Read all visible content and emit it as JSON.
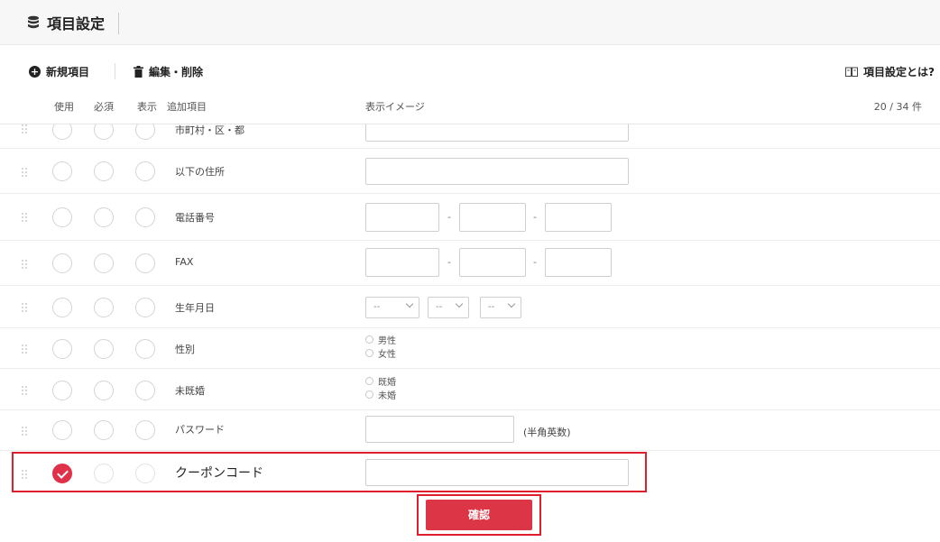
{
  "header": {
    "title": "項目設定",
    "icon": "database-icon"
  },
  "toolbar": {
    "new_label": "新規項目",
    "edit_label": "編集・削除",
    "help_label": "項目設定とは?"
  },
  "columns": {
    "use": "使用",
    "required": "必須",
    "display": "表示",
    "field": "追加項目",
    "image": "表示イメージ",
    "count": "20 / 34 件"
  },
  "rows": {
    "city": {
      "label": "市町村・区・都"
    },
    "address": {
      "label": "以下の住所"
    },
    "phone": {
      "label": "電話番号",
      "sep1": "-",
      "sep2": "-"
    },
    "fax": {
      "label": "FAX",
      "sep1": "-",
      "sep2": "-"
    },
    "birth": {
      "label": "生年月日",
      "sel1": "--",
      "sel2": "--",
      "sel3": "--"
    },
    "gender": {
      "label": "性別",
      "opt1": "男性",
      "opt2": "女性"
    },
    "marital": {
      "label": "未既婚",
      "opt1": "既婚",
      "opt2": "未婚"
    },
    "password": {
      "label": "パスワード",
      "note": "(半角英数)"
    },
    "coupon": {
      "label": "クーポンコード",
      "use_checked": true
    }
  },
  "confirm": {
    "label": "確認"
  },
  "colors": {
    "accent": "#dc3545",
    "highlight": "#e01e2e"
  }
}
